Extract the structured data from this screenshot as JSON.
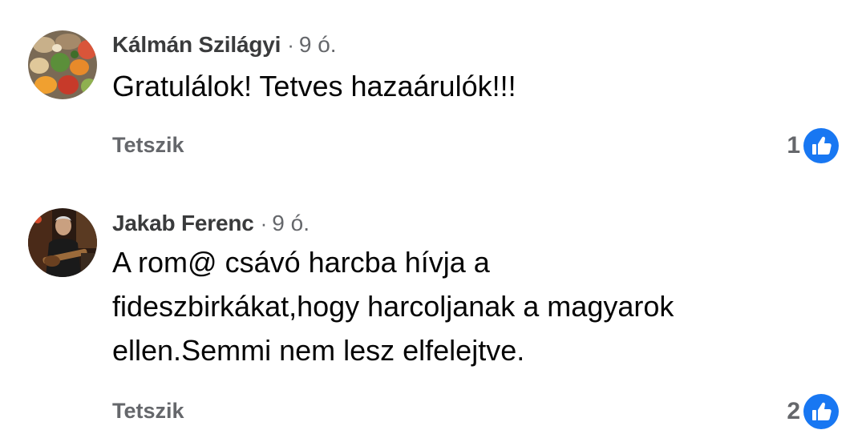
{
  "comments": [
    {
      "author": "Kálmán Szilágyi",
      "separator": "·",
      "time": "9 ó.",
      "text": "Gratulálok! Tetves hazaárulók!!!",
      "like_label": "Tetszik",
      "reaction_count": "1",
      "reaction_icon": "thumbs-up-icon",
      "avatar": "vegetables-photo"
    },
    {
      "author": "Jakab Ferenc",
      "separator": "·",
      "time": "9 ó.",
      "text": "A rom@ csávó harcba hívja a\nfideszbirkákat,hogy harcoljanak a magyarok\nellen.Semmi nem lesz elfelejtve.",
      "like_label": "Tetszik",
      "reaction_count": "2",
      "reaction_icon": "thumbs-up-icon",
      "avatar": "guitarist-photo"
    }
  ],
  "colors": {
    "author": "#3a3b3c",
    "meta": "#65676b",
    "body": "#050505",
    "like_blue": "#1877f2"
  }
}
